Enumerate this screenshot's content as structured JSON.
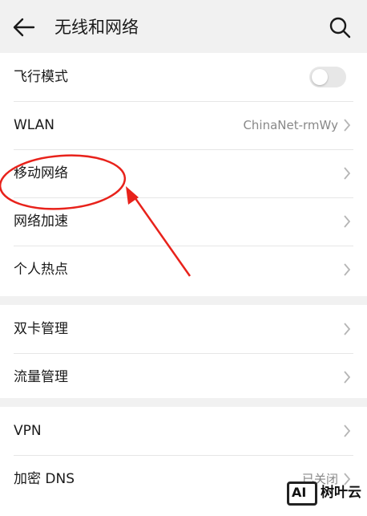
{
  "header": {
    "title": "无线和网络",
    "back_icon": "arrow-left-icon",
    "search_icon": "search-icon"
  },
  "groups": [
    {
      "rows": [
        {
          "label": "飞行模式",
          "control": "toggle",
          "toggle_on": false
        },
        {
          "label": "WLAN",
          "value": "ChinaNet-rmWy"
        },
        {
          "label": "移动网络"
        },
        {
          "label": "网络加速"
        },
        {
          "label": "个人热点"
        }
      ]
    },
    {
      "rows": [
        {
          "label": "双卡管理"
        },
        {
          "label": "流量管理"
        }
      ]
    },
    {
      "rows": [
        {
          "label": "VPN"
        },
        {
          "label": "加密 DNS",
          "value": "已关闭"
        }
      ]
    }
  ],
  "annotation": {
    "color": "#e8221b",
    "target": "移动网络"
  },
  "watermark": {
    "logo": "AI",
    "text": "树叶云"
  },
  "colors": {
    "background": "#f1f1f1",
    "card": "#ffffff",
    "divider": "#e6e6e6",
    "secondary_text": "#888888"
  }
}
